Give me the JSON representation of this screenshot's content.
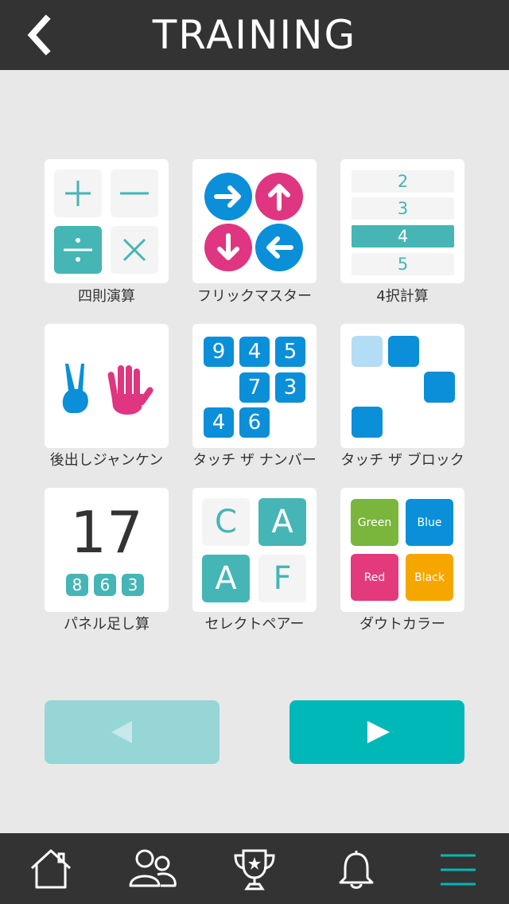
{
  "header": {
    "title": "TRAINING"
  },
  "games": [
    {
      "label": "四則演算"
    },
    {
      "label": "フリックマスター"
    },
    {
      "label": "4択計算",
      "choices": [
        "2",
        "3",
        "4",
        "5"
      ]
    },
    {
      "label": "後出しジャンケン"
    },
    {
      "label": "タッチ ザ ナンバー",
      "numbers": [
        "9",
        "4",
        "5",
        "7",
        "3",
        "4",
        "6"
      ]
    },
    {
      "label": "タッチ ザ ブロック"
    },
    {
      "label": "パネル足し算",
      "total": "17",
      "numbers": [
        "8",
        "6",
        "3"
      ]
    },
    {
      "label": "セレクトペアー",
      "letters": [
        "C",
        "A",
        "A",
        "F"
      ]
    },
    {
      "label": "ダウトカラー",
      "colors": [
        "Green",
        "Blue",
        "Red",
        "Black"
      ]
    }
  ],
  "colors": {
    "teal": "#45b5b5",
    "blue": "#0a8fd8",
    "pink": "#e03580",
    "green": "#7ab53c",
    "red": "#e33a7c",
    "orange": "#f5a700",
    "pager_prev": "#96d6d6",
    "pager_next": "#00b8b8"
  },
  "icons": {
    "back": "chevron-left-icon",
    "prev": "triangle-left-icon",
    "next": "triangle-right-icon",
    "nav": [
      "home-icon",
      "friends-icon",
      "trophy-icon",
      "bell-icon",
      "menu-icon"
    ]
  }
}
